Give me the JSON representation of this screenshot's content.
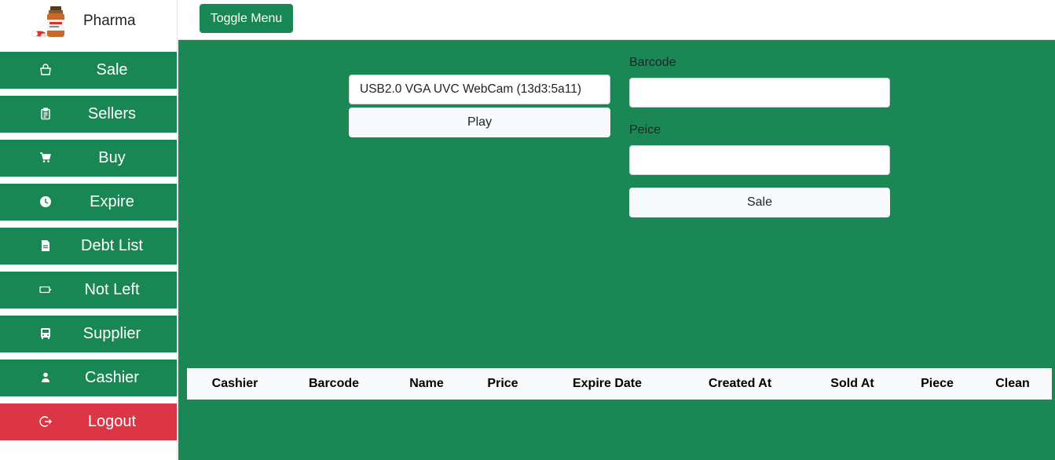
{
  "brand": {
    "name": "Pharma",
    "logo_icon": "medicine-bottle-icon"
  },
  "sidebar": {
    "items": [
      {
        "label": "Sale",
        "icon": "shopping-bag-icon"
      },
      {
        "label": "Sellers",
        "icon": "clipboard-icon"
      },
      {
        "label": "Buy",
        "icon": "cart-icon"
      },
      {
        "label": "Expire",
        "icon": "clock-icon"
      },
      {
        "label": "Debt List",
        "icon": "document-icon"
      },
      {
        "label": "Not Left",
        "icon": "battery-empty-icon"
      },
      {
        "label": "Supplier",
        "icon": "bus-icon"
      },
      {
        "label": "Cashier",
        "icon": "person-icon"
      },
      {
        "label": "Logout",
        "icon": "logout-icon"
      }
    ]
  },
  "topbar": {
    "toggle_label": "Toggle Menu"
  },
  "scanner": {
    "camera_selected": "USB2.0 VGA UVC WebCam (13d3:5a11)",
    "play_label": "Play"
  },
  "form": {
    "barcode_label": "Barcode",
    "barcode_value": "",
    "piece_label": "Peice",
    "piece_value": "",
    "sale_label": "Sale"
  },
  "table": {
    "columns": [
      "Cashier",
      "Barcode",
      "Name",
      "Price",
      "Expire Date",
      "Created At",
      "Sold At",
      "Piece",
      "Clean"
    ],
    "rows": []
  },
  "colors": {
    "primary": "#198754",
    "danger": "#dc3545",
    "light": "#f8f9fa"
  }
}
